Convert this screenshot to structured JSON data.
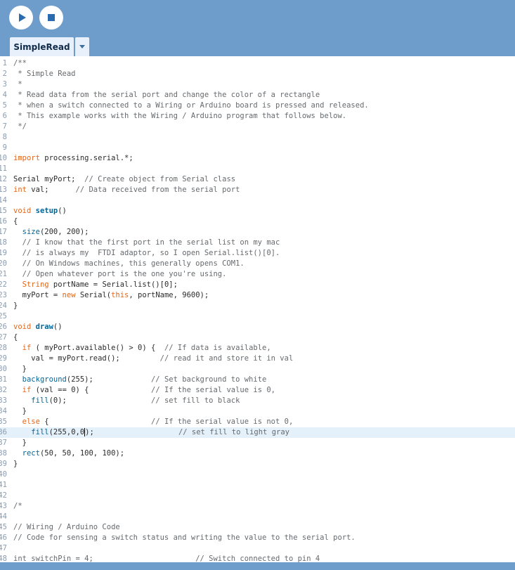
{
  "toolbar": {
    "run_icon": "play-icon",
    "stop_icon": "stop-icon",
    "accent": "#2a6bb0"
  },
  "tabs": [
    {
      "label": "SimpleRead",
      "active": true
    }
  ],
  "editor": {
    "active_line": 36,
    "lines": [
      {
        "n": "1",
        "segs": [
          {
            "t": "/**",
            "c": "comment"
          }
        ]
      },
      {
        "n": "2",
        "segs": [
          {
            "t": " * Simple Read",
            "c": "comment"
          }
        ]
      },
      {
        "n": "3",
        "segs": [
          {
            "t": " *",
            "c": "comment"
          }
        ]
      },
      {
        "n": "4",
        "segs": [
          {
            "t": " * Read data from the serial port and change the color of a rectangle",
            "c": "comment"
          }
        ]
      },
      {
        "n": "5",
        "segs": [
          {
            "t": " * when a switch connected to a Wiring or Arduino board is pressed and released.",
            "c": "comment"
          }
        ]
      },
      {
        "n": "6",
        "segs": [
          {
            "t": " * This example works with the Wiring / Arduino program that follows below.",
            "c": "comment"
          }
        ]
      },
      {
        "n": "7",
        "segs": [
          {
            "t": " */",
            "c": "comment"
          }
        ]
      },
      {
        "n": "8",
        "segs": []
      },
      {
        "n": "9",
        "segs": []
      },
      {
        "n": "10",
        "segs": [
          {
            "t": "import",
            "c": "kw"
          },
          {
            "t": " processing.serial.*;",
            "c": ""
          }
        ]
      },
      {
        "n": "11",
        "segs": []
      },
      {
        "n": "12",
        "segs": [
          {
            "t": "Serial myPort;  ",
            "c": ""
          },
          {
            "t": "// Create object from Serial class",
            "c": "comment"
          }
        ]
      },
      {
        "n": "13",
        "segs": [
          {
            "t": "int",
            "c": "type"
          },
          {
            "t": " val;      ",
            "c": ""
          },
          {
            "t": "// Data received from the serial port",
            "c": "comment"
          }
        ]
      },
      {
        "n": "14",
        "segs": []
      },
      {
        "n": "15",
        "segs": [
          {
            "t": "void",
            "c": "kw"
          },
          {
            "t": " ",
            "c": ""
          },
          {
            "t": "setup",
            "c": "func"
          },
          {
            "t": "()",
            "c": ""
          }
        ]
      },
      {
        "n": "16",
        "segs": [
          {
            "t": "{",
            "c": ""
          }
        ]
      },
      {
        "n": "17",
        "segs": [
          {
            "t": "  ",
            "c": ""
          },
          {
            "t": "size",
            "c": "fn"
          },
          {
            "t": "(200, 200);",
            "c": ""
          }
        ]
      },
      {
        "n": "18",
        "segs": [
          {
            "t": "  // I know that the first port in the serial list on my mac",
            "c": "comment"
          }
        ]
      },
      {
        "n": "19",
        "segs": [
          {
            "t": "  // is always my  FTDI adaptor, so I open Serial.list()[0].",
            "c": "comment"
          }
        ]
      },
      {
        "n": "20",
        "segs": [
          {
            "t": "  // On Windows machines, this generally opens COM1.",
            "c": "comment"
          }
        ]
      },
      {
        "n": "21",
        "segs": [
          {
            "t": "  // Open whatever port is the one you're using.",
            "c": "comment"
          }
        ]
      },
      {
        "n": "22",
        "segs": [
          {
            "t": "  ",
            "c": ""
          },
          {
            "t": "String",
            "c": "type"
          },
          {
            "t": " portName = Serial.list()[0];",
            "c": ""
          }
        ]
      },
      {
        "n": "23",
        "segs": [
          {
            "t": "  myPort = ",
            "c": ""
          },
          {
            "t": "new",
            "c": "kw"
          },
          {
            "t": " Serial(",
            "c": ""
          },
          {
            "t": "this",
            "c": "kw"
          },
          {
            "t": ", portName, 9600);",
            "c": ""
          }
        ]
      },
      {
        "n": "24",
        "segs": [
          {
            "t": "}",
            "c": ""
          }
        ]
      },
      {
        "n": "25",
        "segs": []
      },
      {
        "n": "26",
        "segs": [
          {
            "t": "void",
            "c": "kw"
          },
          {
            "t": " ",
            "c": ""
          },
          {
            "t": "draw",
            "c": "func"
          },
          {
            "t": "()",
            "c": ""
          }
        ]
      },
      {
        "n": "27",
        "segs": [
          {
            "t": "{",
            "c": ""
          }
        ]
      },
      {
        "n": "28",
        "segs": [
          {
            "t": "  ",
            "c": ""
          },
          {
            "t": "if",
            "c": "kw"
          },
          {
            "t": " ( myPort.available() > 0) {  ",
            "c": ""
          },
          {
            "t": "// If data is available,",
            "c": "comment"
          }
        ]
      },
      {
        "n": "29",
        "segs": [
          {
            "t": "    val = myPort.read();         ",
            "c": ""
          },
          {
            "t": "// read it and store it in val",
            "c": "comment"
          }
        ]
      },
      {
        "n": "30",
        "segs": [
          {
            "t": "  }",
            "c": ""
          }
        ]
      },
      {
        "n": "31",
        "segs": [
          {
            "t": "  ",
            "c": ""
          },
          {
            "t": "background",
            "c": "fn"
          },
          {
            "t": "(255);             ",
            "c": ""
          },
          {
            "t": "// Set background to white",
            "c": "comment"
          }
        ]
      },
      {
        "n": "32",
        "segs": [
          {
            "t": "  ",
            "c": ""
          },
          {
            "t": "if",
            "c": "kw"
          },
          {
            "t": " (val == 0) {              ",
            "c": ""
          },
          {
            "t": "// If the serial value is 0,",
            "c": "comment"
          }
        ]
      },
      {
        "n": "33",
        "segs": [
          {
            "t": "    ",
            "c": ""
          },
          {
            "t": "fill",
            "c": "fn"
          },
          {
            "t": "(0);                   ",
            "c": ""
          },
          {
            "t": "// set fill to black",
            "c": "comment"
          }
        ]
      },
      {
        "n": "34",
        "segs": [
          {
            "t": "  }",
            "c": ""
          }
        ]
      },
      {
        "n": "35",
        "segs": [
          {
            "t": "  ",
            "c": ""
          },
          {
            "t": "else",
            "c": "kw"
          },
          {
            "t": " {                       ",
            "c": ""
          },
          {
            "t": "// If the serial value is not 0,",
            "c": "comment"
          }
        ]
      },
      {
        "n": "36",
        "segs": [
          {
            "t": "    ",
            "c": ""
          },
          {
            "t": "fill",
            "c": "fn"
          },
          {
            "t": "(255,0,0",
            "c": ""
          },
          {
            "t": "|",
            "c": "cursor"
          },
          {
            "t": ");                   ",
            "c": ""
          },
          {
            "t": "// set fill to light gray",
            "c": "comment"
          }
        ]
      },
      {
        "n": "37",
        "segs": [
          {
            "t": "  }",
            "c": ""
          }
        ]
      },
      {
        "n": "38",
        "segs": [
          {
            "t": "  ",
            "c": ""
          },
          {
            "t": "rect",
            "c": "fn"
          },
          {
            "t": "(50, 50, 100, 100);",
            "c": ""
          }
        ]
      },
      {
        "n": "39",
        "segs": [
          {
            "t": "}",
            "c": ""
          }
        ]
      },
      {
        "n": "40",
        "segs": []
      },
      {
        "n": "41",
        "segs": []
      },
      {
        "n": "42",
        "segs": []
      },
      {
        "n": "43",
        "segs": [
          {
            "t": "/*",
            "c": "comment"
          }
        ]
      },
      {
        "n": "44",
        "segs": []
      },
      {
        "n": "45",
        "segs": [
          {
            "t": "// Wiring / Arduino Code",
            "c": "comment"
          }
        ]
      },
      {
        "n": "46",
        "segs": [
          {
            "t": "// Code for sensing a switch status and writing the value to the serial port.",
            "c": "comment"
          }
        ]
      },
      {
        "n": "47",
        "segs": []
      },
      {
        "n": "48",
        "segs": [
          {
            "t": "int switchPin = 4;                       ",
            "c": "comment"
          },
          {
            "t": "// Switch connected to pin 4",
            "c": "comment"
          }
        ]
      }
    ]
  }
}
